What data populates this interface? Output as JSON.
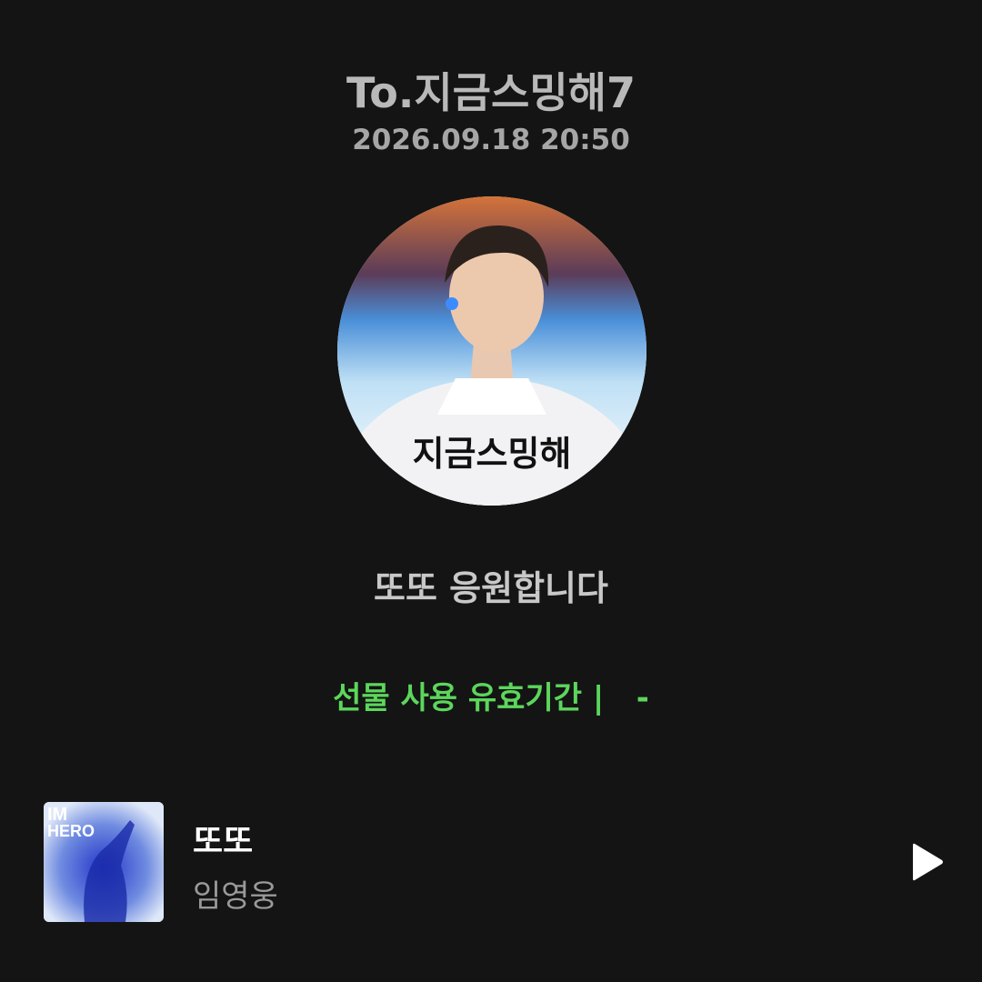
{
  "header": {
    "recipient": "To.지금스밍해7",
    "timestamp": "2026.09.18 20:50"
  },
  "avatar": {
    "caption": "지금스밍해"
  },
  "message": "또또 응원합니다",
  "gift": {
    "expiry_text": "선물 사용 유효기간 |   -"
  },
  "track": {
    "title": "또또",
    "artist": "임영웅",
    "album_text_top": "IM",
    "album_text_bottom": "HERO"
  },
  "icons": {
    "play": "play-icon"
  },
  "colors": {
    "background": "#141414",
    "accent_green": "#5cd65c",
    "title_white": "#ffffff"
  }
}
